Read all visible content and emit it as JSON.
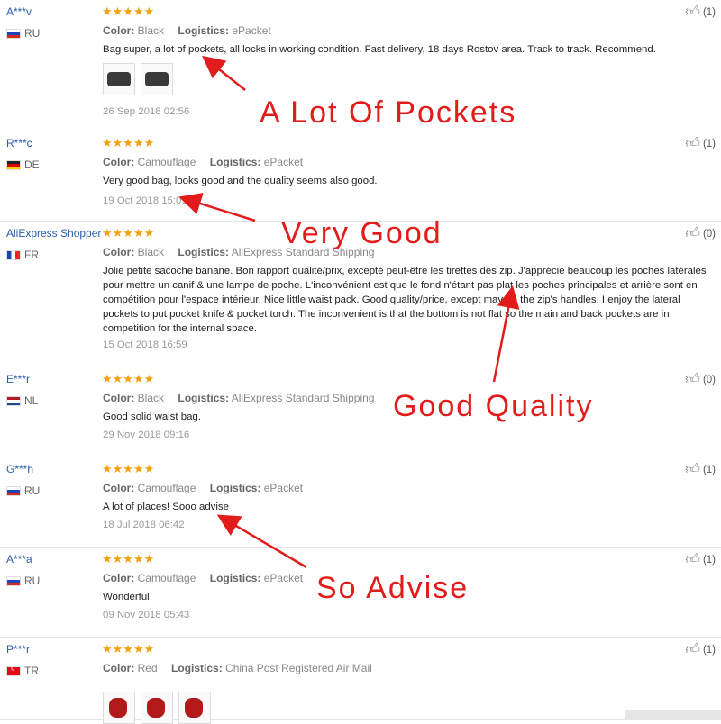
{
  "reviews": [
    {
      "user": "A***v",
      "country": "RU",
      "flag": "ru",
      "stars": "★★★★★",
      "color_label": "Color:",
      "color": "Black",
      "logistics_label": "Logistics:",
      "logistics": "ePacket",
      "text": "Bag super, a lot of pockets, all locks in working condition. Fast delivery, 18 days Rostov area. Track to track. Recommend.",
      "date": "26 Sep 2018 02:56",
      "helpful": "(1)",
      "photos": 2,
      "photo_style": "dark"
    },
    {
      "user": "R***c",
      "country": "DE",
      "flag": "de",
      "stars": "★★★★★",
      "color_label": "Color:",
      "color": "Camouflage",
      "logistics_label": "Logistics:",
      "logistics": "ePacket",
      "text": "Very good bag, looks good and the quality seems also good.",
      "date": "19 Oct 2018 15:09",
      "helpful": "(1)",
      "photos": 0
    },
    {
      "user": "AliExpress Shopper",
      "country": "FR",
      "flag": "fr",
      "stars": "★★★★★",
      "color_label": "Color:",
      "color": "Black",
      "logistics_label": "Logistics:",
      "logistics": "AliExpress Standard Shipping",
      "text": "Jolie petite sacoche banane. Bon rapport qualité/prix, excepté peut-être les tirettes des zip. J'apprécie beaucoup les poches latérales pour mettre un canif & une lampe de poche. L'inconvénient est que le fond n'étant pas plat les poches principales et arrière sont en compétition pour l'espace intérieur. Nice little waist pack. Good quality/price, except may be the zip's handles. I enjoy the lateral pockets to put pocket knife & pocket torch. The inconvenient is that the bottom is not flat so the main and back pockets are in competition for the internal space.",
      "date": "15 Oct 2018 16:59",
      "helpful": "(0)",
      "photos": 0
    },
    {
      "user": "E***r",
      "country": "NL",
      "flag": "nl",
      "stars": "★★★★★",
      "color_label": "Color:",
      "color": "Black",
      "logistics_label": "Logistics:",
      "logistics": "AliExpress Standard Shipping",
      "text": "Good solid waist bag.",
      "date": "29 Nov 2018 09:16",
      "helpful": "(0)",
      "photos": 0
    },
    {
      "user": "G***h",
      "country": "RU",
      "flag": "ru",
      "stars": "★★★★★",
      "color_label": "Color:",
      "color": "Camouflage",
      "logistics_label": "Logistics:",
      "logistics": "ePacket",
      "text": "A lot of places! Sooo advise",
      "date": "18 Jul 2018 06:42",
      "helpful": "(1)",
      "photos": 0
    },
    {
      "user": "A***a",
      "country": "RU",
      "flag": "ru",
      "stars": "★★★★★",
      "color_label": "Color:",
      "color": "Camouflage",
      "logistics_label": "Logistics:",
      "logistics": "ePacket",
      "text": "Wonderful",
      "date": "09 Nov 2018 05:43",
      "helpful": "(1)",
      "photos": 0
    },
    {
      "user": "P***r",
      "country": "TR",
      "flag": "tr",
      "stars": "★★★★★",
      "color_label": "Color:",
      "color": "Red",
      "logistics_label": "Logistics:",
      "logistics": "China Post Registered Air Mail",
      "text": "",
      "date": "",
      "helpful": "(1)",
      "photos": 3,
      "photo_style": "red"
    }
  ],
  "annotations": [
    {
      "text": "A Lot Of Pockets"
    },
    {
      "text": "Very Good"
    },
    {
      "text": "Good Quality"
    },
    {
      "text": "So Advise"
    }
  ],
  "colors": {
    "accent_red": "#e21b1b",
    "star": "#f2a20f",
    "link": "#2a5db0"
  },
  "icons": {
    "helpful": "thumbs-up-icon",
    "rating": "star-icon"
  }
}
